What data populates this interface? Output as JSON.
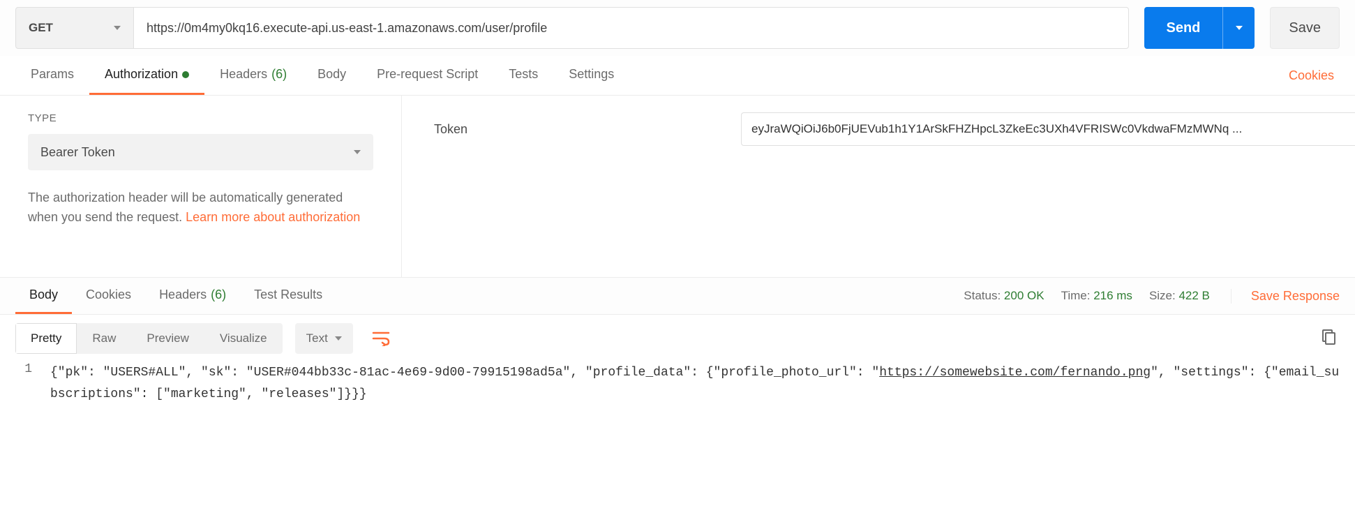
{
  "request": {
    "method": "GET",
    "url": "https://0m4my0kq16.execute-api.us-east-1.amazonaws.com/user/profile",
    "send": "Send",
    "save": "Save"
  },
  "tabs": {
    "params": "Params",
    "authorization": "Authorization",
    "headers": "Headers",
    "headers_count": "(6)",
    "body": "Body",
    "prerequest": "Pre-request Script",
    "tests": "Tests",
    "settings": "Settings",
    "cookies": "Cookies"
  },
  "auth": {
    "type_label": "TYPE",
    "type_value": "Bearer Token",
    "help_text_1": "The authorization header will be automatically generated when you send the request. ",
    "help_link": "Learn more about authorization",
    "token_label": "Token",
    "token_value": "eyJraWQiOiJ6b0FjUEVub1h1Y1ArSkFHZHpcL3ZkeEc3UXh4VFRISWc0VkdwaFMzMWNq ..."
  },
  "response": {
    "tabs": {
      "body": "Body",
      "cookies": "Cookies",
      "headers": "Headers",
      "headers_count": "(6)",
      "test_results": "Test Results"
    },
    "meta": {
      "status_label": "Status:",
      "status_value": "200 OK",
      "time_label": "Time:",
      "time_value": "216 ms",
      "size_label": "Size:",
      "size_value": "422 B",
      "save_response": "Save Response"
    },
    "view": {
      "pretty": "Pretty",
      "raw": "Raw",
      "preview": "Preview",
      "visualize": "Visualize",
      "format": "Text"
    },
    "body_line_no": "1",
    "body_prefix": "{\"pk\": \"USERS#ALL\", \"sk\": \"USER#044bb33c-81ac-4e69-9d00-79915198ad5a\", \"profile_data\": {\"profile_photo_url\": \"",
    "body_url": "https://somewebsite.com/fernando.png",
    "body_suffix": "\", \"settings\": {\"email_subscriptions\": [\"marketing\", \"releases\"]}}}"
  }
}
